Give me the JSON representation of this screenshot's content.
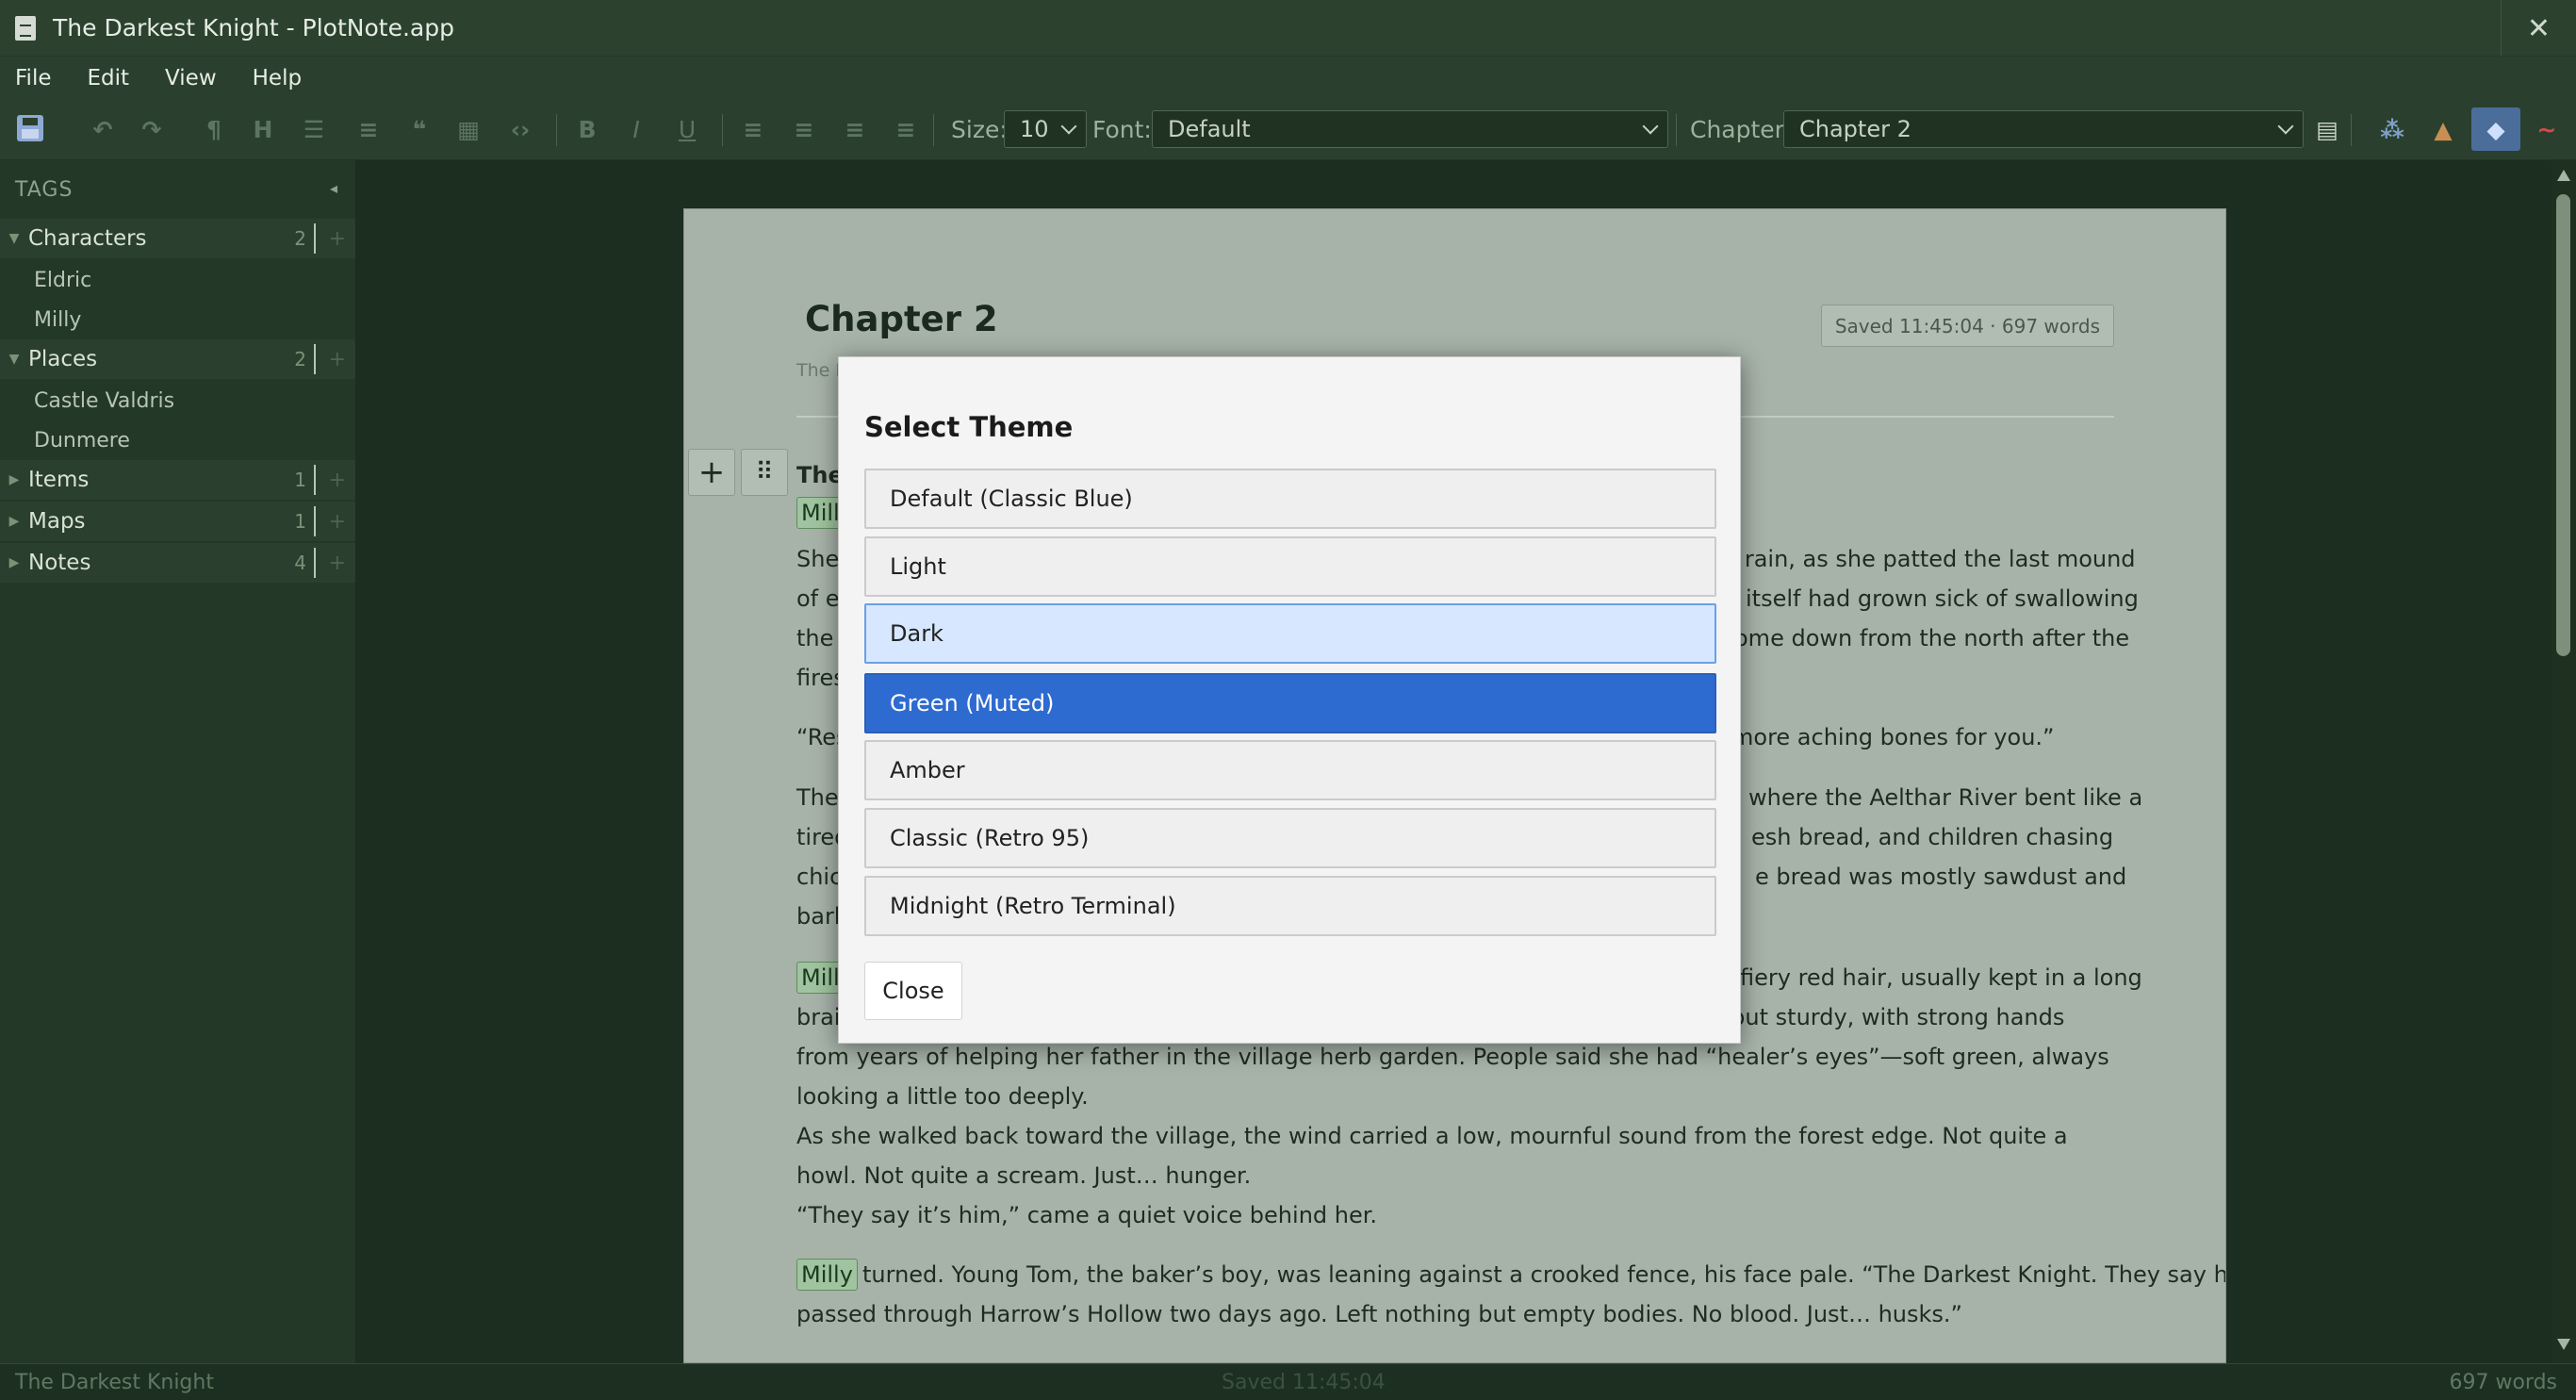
{
  "window": {
    "title": "The Darkest Knight - PlotNote.app",
    "close_glyph": "✕"
  },
  "menu": [
    "File",
    "Edit",
    "View",
    "Help"
  ],
  "toolbar": {
    "size_label": "Size:",
    "size_value": "10",
    "font_label": "Font:",
    "font_value": "Default",
    "chapter_label": "Chapter:",
    "chapter_value": "Chapter 2"
  },
  "sidebar": {
    "header": "TAGS",
    "groups": [
      {
        "name": "Characters",
        "count": "2",
        "items": [
          "Eldric",
          "Milly"
        ]
      },
      {
        "name": "Places",
        "count": "2",
        "items": [
          "Castle Valdris",
          "Dunmere"
        ]
      },
      {
        "name": "Items",
        "count": "1",
        "items": []
      },
      {
        "name": "Maps",
        "count": "1",
        "items": []
      },
      {
        "name": "Notes",
        "count": "4",
        "items": []
      }
    ]
  },
  "page": {
    "title": "Chapter 2",
    "saved": "Saved 11:45:04 · 697 words",
    "subtitle": "The I",
    "section": "The",
    "lines": {
      "l1a": "She",
      "l1b": "n rain, as she patted the last mound",
      "l2a": "of e",
      "l2b": "itself had grown sick of swallowing",
      "l3a": "the",
      "l3b": "ome down from the north after the",
      "l4a": "fires",
      "l5a": "“Res",
      "l5b": "more aching bones for you.”",
      "l6a": "The",
      "l6b": "where the Aelthar River bent like a",
      "l7a": "tired",
      "l7b": "esh bread, and children chasing",
      "l8a": "chic",
      "l8b": "e bread was mostly sawdust and",
      "l9a": "barl",
      "l10b": "fiery red hair, usually kept in a long",
      "p1": "braid, had come loose in the rain and stuck to her freckled cheeks. She was small but sturdy, with strong hands from years of helping her father in the village herb garden. People said she had “healer’s eyes”—soft green, always looking a little too deeply.",
      "p2": "As she walked back toward the village, the wind carried a low, mournful sound from the forest edge. Not quite a howl. Not quite a scream. Just… hunger.",
      "p3": "“They say it’s him,” came a quiet voice behind her.",
      "p4": "turned. Young Tom, the baker’s boy, was leaning against a crooked fence, his face pale. “The Darkest Knight. They say he",
      "p5": "passed through Harrow’s Hollow two days ago. Left nothing but empty bodies. No blood. Just… husks.”"
    },
    "tags": {
      "milly": "Milly",
      "milly_short": "Mill"
    }
  },
  "modal": {
    "title": "Select Theme",
    "options": [
      "Default (Classic Blue)",
      "Light",
      "Dark",
      "Green (Muted)",
      "Amber",
      "Classic (Retro 95)",
      "Midnight (Retro Terminal)"
    ],
    "hovered": "Dark",
    "selected": "Green (Muted)",
    "close_label": "Close"
  },
  "status": {
    "left": "The Darkest Knight",
    "middle": "Saved 11:45:04",
    "right": "697 words"
  },
  "colors": {
    "selected_theme": "#2e6bd0",
    "hover_theme": "#d6e7ff",
    "tag_highlight": "#9fc49f"
  }
}
